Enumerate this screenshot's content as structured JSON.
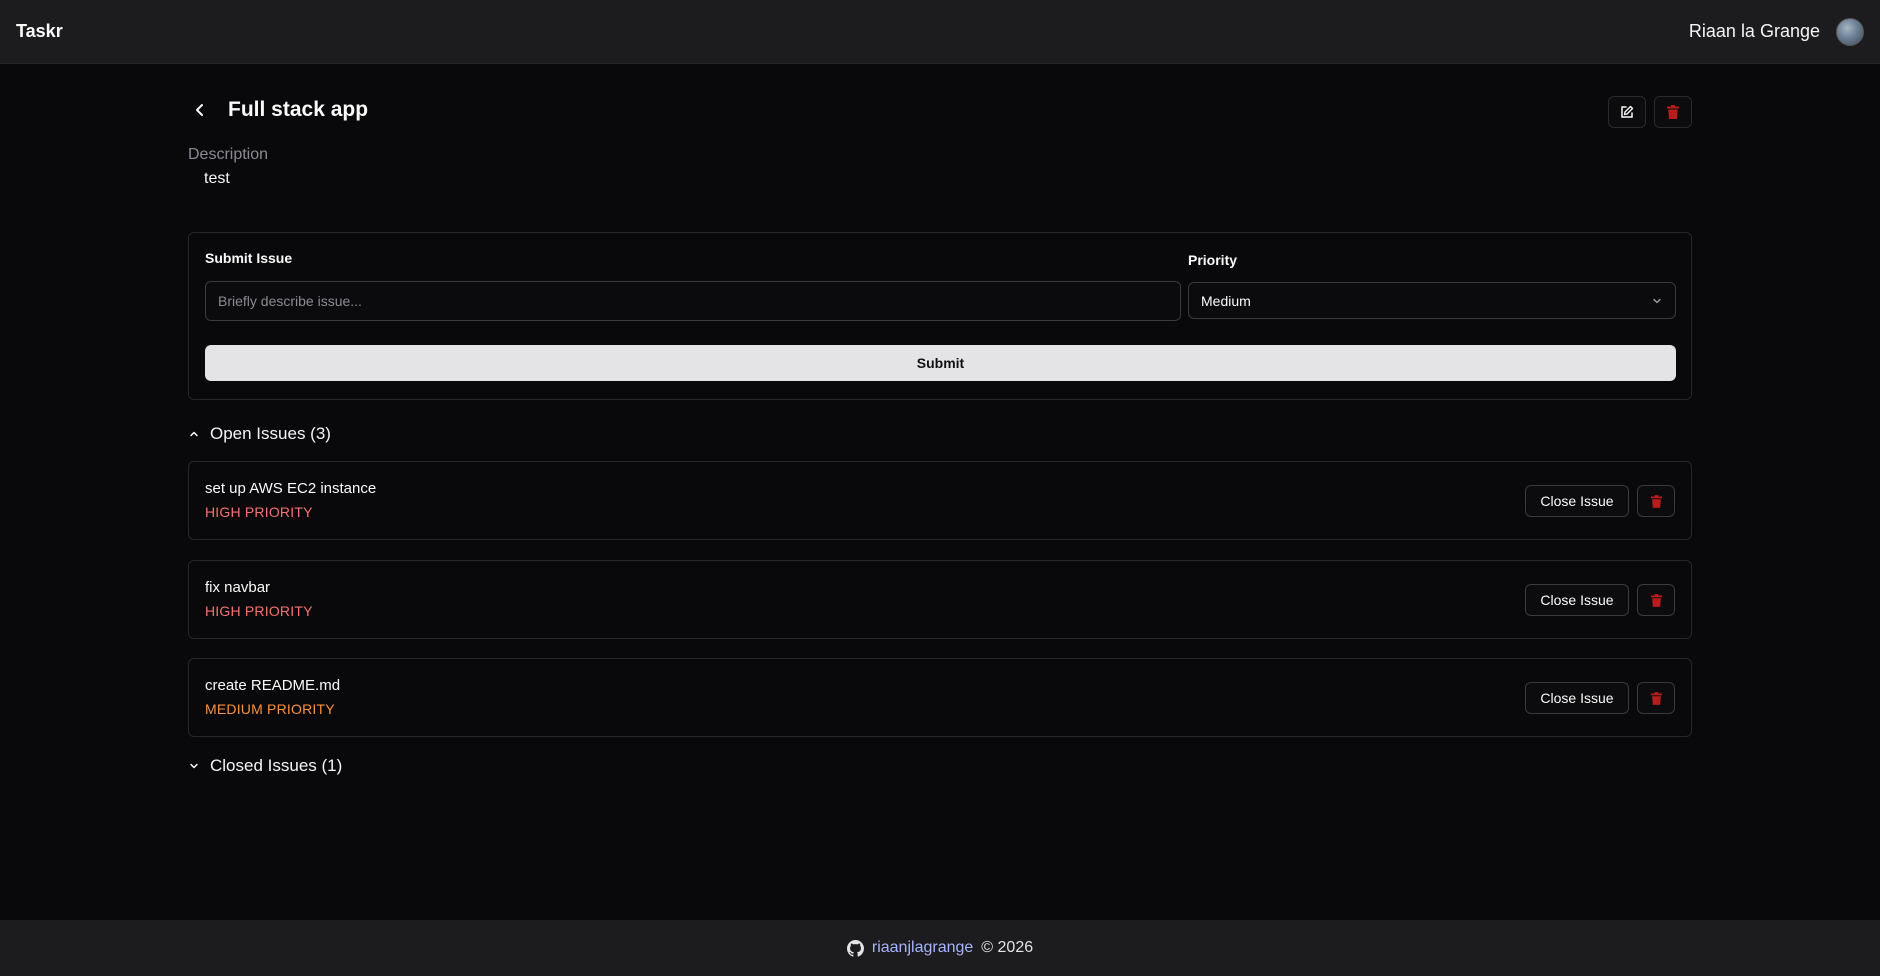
{
  "header": {
    "brand": "Taskr",
    "user_name": "Riaan la Grange"
  },
  "project": {
    "title": "Full stack app",
    "description_label": "Description",
    "description": "test"
  },
  "submit_form": {
    "issue_label": "Submit Issue",
    "issue_placeholder": "Briefly describe issue...",
    "priority_label": "Priority",
    "priority_value": "Medium",
    "submit_label": "Submit"
  },
  "open_section": {
    "label": "Open Issues (3)",
    "expanded": true
  },
  "open_issues": [
    {
      "title": "set up AWS EC2 instance",
      "priority": "HIGH PRIORITY",
      "close_label": "Close Issue"
    },
    {
      "title": "fix navbar",
      "priority": "HIGH PRIORITY",
      "close_label": "Close Issue"
    },
    {
      "title": "create README.md",
      "priority": "MEDIUM PRIORITY",
      "close_label": "Close Issue"
    }
  ],
  "closed_section": {
    "label": "Closed Issues (1)",
    "expanded": false
  },
  "footer": {
    "link": "riaanjlagrange",
    "copyright": "© 2026"
  },
  "colors": {
    "background": "#09090b",
    "high_priority": "#f87171",
    "medium_priority": "#fb923c",
    "delete_icon": "#b91c1c",
    "link": "#a5b4fc"
  },
  "icons": [
    "chevron-left-icon",
    "edit-icon",
    "trash-icon",
    "chevron-down-icon",
    "chevron-up-icon",
    "github-icon"
  ]
}
